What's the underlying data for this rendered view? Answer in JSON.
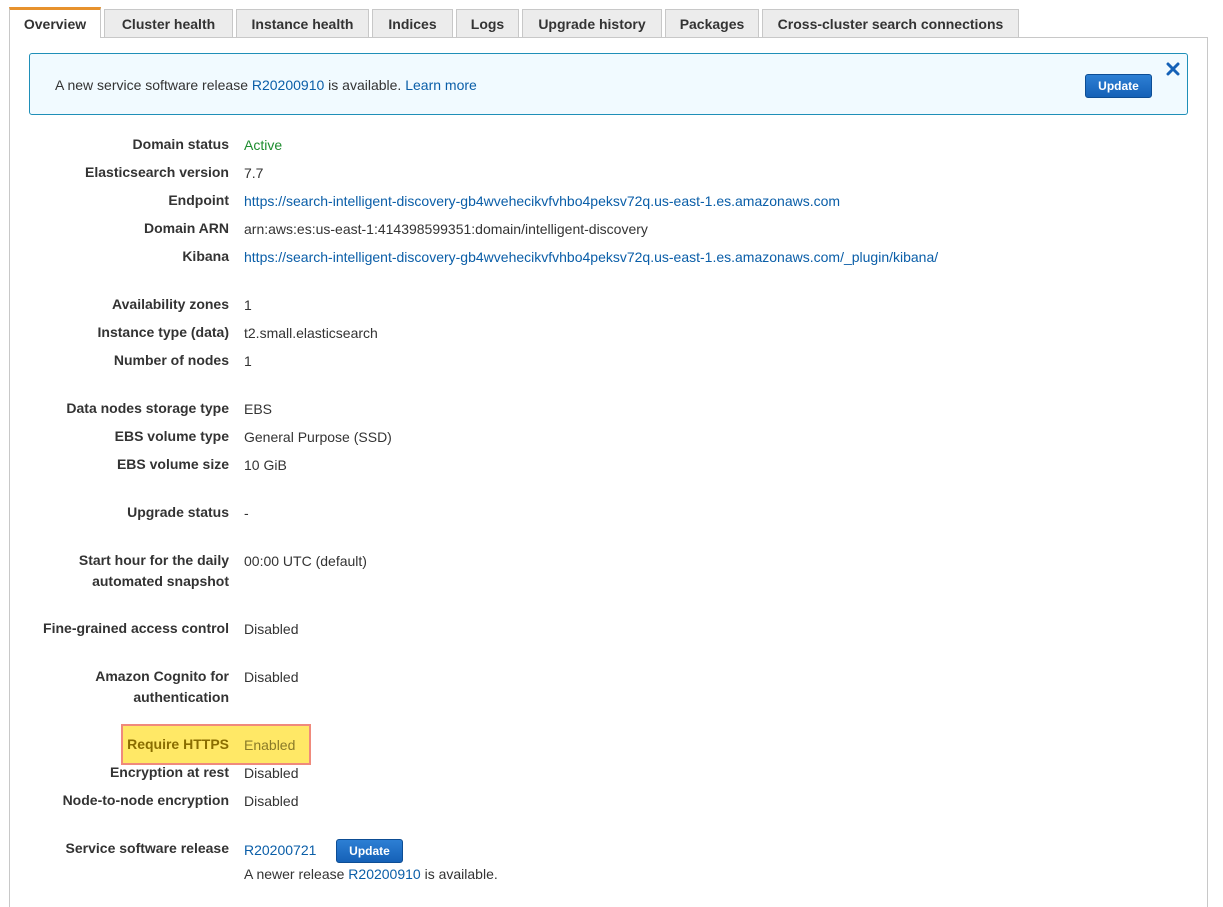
{
  "tabs": [
    {
      "label": "Overview"
    },
    {
      "label": "Cluster health"
    },
    {
      "label": "Instance health"
    },
    {
      "label": "Indices"
    },
    {
      "label": "Logs"
    },
    {
      "label": "Upgrade history"
    },
    {
      "label": "Packages"
    },
    {
      "label": "Cross-cluster search connections"
    }
  ],
  "banner": {
    "text_before": "A new service software release ",
    "release_link": "R20200910",
    "text_after": " is available. ",
    "learn_more": "Learn more",
    "update_label": "Update",
    "close_icon": "close-icon"
  },
  "details": {
    "domain_status": {
      "label": "Domain status",
      "value": "Active"
    },
    "es_version": {
      "label": "Elasticsearch version",
      "value": "7.7"
    },
    "endpoint": {
      "label": "Endpoint",
      "value": "https://search-intelligent-discovery-gb4wvehecikvfvhbo4peksv72q.us-east-1.es.amazonaws.com"
    },
    "domain_arn": {
      "label": "Domain ARN",
      "value": "arn:aws:es:us-east-1:414398599351:domain/intelligent-discovery"
    },
    "kibana": {
      "label": "Kibana",
      "value": "https://search-intelligent-discovery-gb4wvehecikvfvhbo4peksv72q.us-east-1.es.amazonaws.com/_plugin/kibana/"
    },
    "availability_zones": {
      "label": "Availability zones",
      "value": "1"
    },
    "instance_type": {
      "label": "Instance type (data)",
      "value": "t2.small.elasticsearch"
    },
    "number_of_nodes": {
      "label": "Number of nodes",
      "value": "1"
    },
    "storage_type": {
      "label": "Data nodes storage type",
      "value": "EBS"
    },
    "ebs_volume_type": {
      "label": "EBS volume type",
      "value": "General Purpose (SSD)"
    },
    "ebs_volume_size": {
      "label": "EBS volume size",
      "value": "10 GiB"
    },
    "upgrade_status": {
      "label": "Upgrade status",
      "value": "-"
    },
    "snapshot_hour": {
      "label_line1": "Start hour for the daily",
      "label_line2": "automated snapshot",
      "value": "00:00 UTC (default)"
    },
    "fine_grained": {
      "label": "Fine-grained access control",
      "value": "Disabled"
    },
    "cognito": {
      "label_line1": "Amazon Cognito for",
      "label_line2": "authentication",
      "value": "Disabled"
    },
    "require_https": {
      "label": "Require HTTPS",
      "value": "Enabled"
    },
    "encryption_rest": {
      "label": "Encryption at rest",
      "value": "Disabled"
    },
    "node_encryption": {
      "label": "Node-to-node encryption",
      "value": "Disabled"
    },
    "service_release": {
      "label": "Service software release",
      "value": "R20200721",
      "update_label": "Update",
      "note_before": "A newer release ",
      "note_link": "R20200910",
      "note_after": " is available."
    }
  },
  "colors": {
    "active_tab_accent": "#e7922d",
    "banner_border": "#1f8fb8",
    "link": "#0a5ea8",
    "status_active": "#1e8d2f",
    "highlight_fill": "#ffe866",
    "highlight_border": "#f08a7c"
  }
}
